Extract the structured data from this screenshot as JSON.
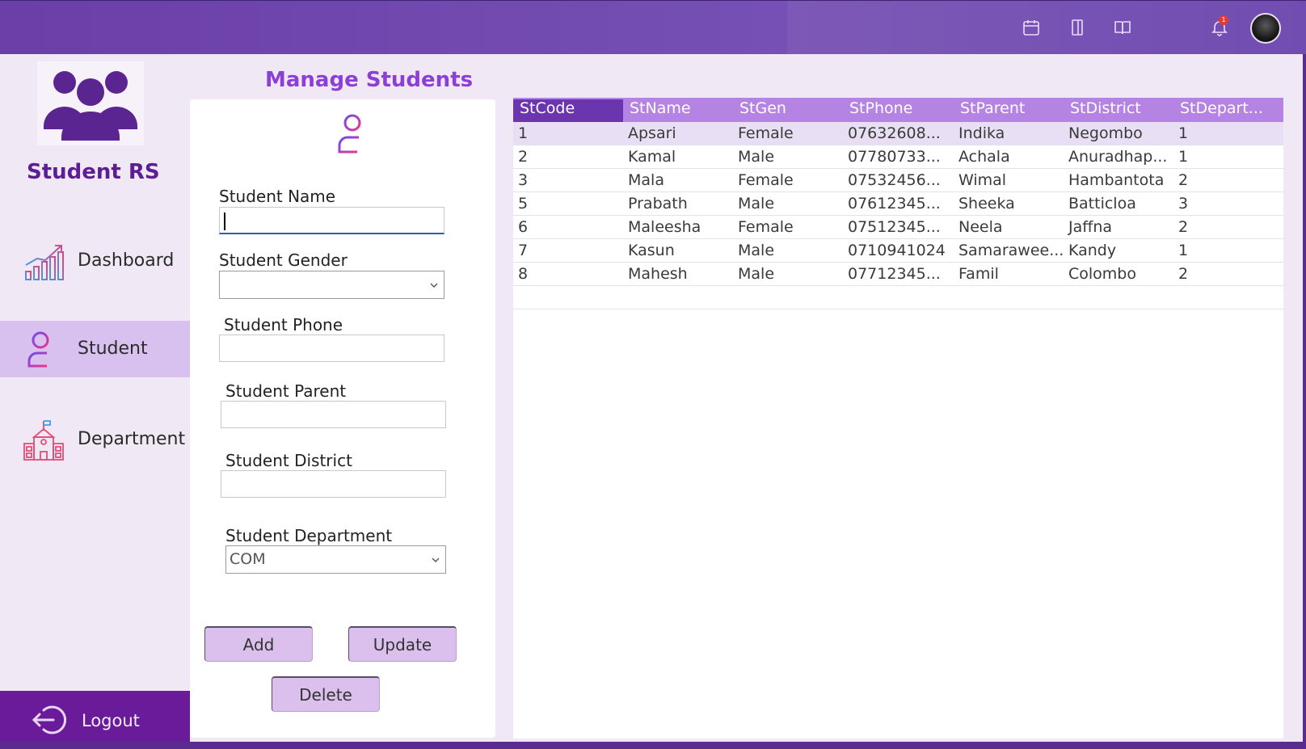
{
  "app": {
    "name": "Student RS"
  },
  "topbar": {
    "icons": [
      "calendar-icon",
      "bookmark-icon",
      "book-open-icon",
      "bell-icon"
    ],
    "notification_count": "1"
  },
  "sidebar": {
    "items": [
      {
        "label": "Dashboard",
        "icon": "chart-growth-icon",
        "active": false
      },
      {
        "label": "Student",
        "icon": "add-user-icon",
        "active": true
      },
      {
        "label": "Department",
        "icon": "school-building-icon",
        "active": false
      }
    ],
    "logout_label": "Logout"
  },
  "form": {
    "title": "Manage Students",
    "fields": {
      "name_label": "Student Name",
      "name_value": "",
      "gender_label": "Student Gender",
      "gender_value": "",
      "phone_label": "Student Phone",
      "phone_value": "",
      "parent_label": "Student Parent",
      "parent_value": "",
      "district_label": "Student District",
      "district_value": "",
      "department_label": "Student Department",
      "department_value": "COM"
    },
    "buttons": {
      "add": "Add",
      "update": "Update",
      "delete": "Delete"
    }
  },
  "table": {
    "columns": [
      "StCode",
      "StName",
      "StGen",
      "StPhone",
      "StParent",
      "StDistrict",
      "StDepart..."
    ],
    "rows": [
      [
        "1",
        "Apsari",
        "Female",
        "07632608...",
        "Indika",
        "Negombo",
        "1"
      ],
      [
        "2",
        "Kamal",
        "Male",
        "07780733...",
        "Achala",
        "Anuradhap...",
        "1"
      ],
      [
        "3",
        "Mala",
        "Female",
        "07532456...",
        "Wimal",
        "Hambantota",
        "2"
      ],
      [
        "5",
        "Prabath",
        "Male",
        "07612345...",
        "Sheeka",
        "Batticloa",
        "3"
      ],
      [
        "6",
        "Maleesha",
        "Female",
        "07512345...",
        "Neela",
        "Jaffna",
        "2"
      ],
      [
        "7",
        "Kasun",
        "Male",
        "0710941024",
        "Samarawee...",
        "Kandy",
        "1"
      ],
      [
        "8",
        "Mahesh",
        "Male",
        "07712345...",
        "Famil",
        "Colombo",
        "2"
      ]
    ],
    "selected_row": 0
  },
  "colors": {
    "topbar": "#6a3fa8",
    "accent": "#8b3fd6",
    "active_nav": "#d8c0ef",
    "logout_bg": "#6a1b9a",
    "header_bg": "#b584e3"
  }
}
